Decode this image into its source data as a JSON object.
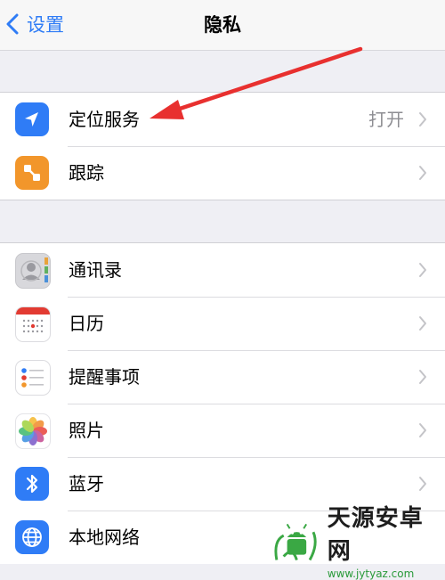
{
  "nav": {
    "back_label": "设置",
    "title": "隐私"
  },
  "group1": [
    {
      "label": "定位服务",
      "value": "打开",
      "icon": "location-arrow-icon",
      "color": "#2f7cf6"
    },
    {
      "label": "跟踪",
      "value": "",
      "icon": "tracking-icon",
      "color": "#f2962b"
    }
  ],
  "group2": [
    {
      "label": "通讯录",
      "icon": "contacts-icon"
    },
    {
      "label": "日历",
      "icon": "calendar-icon"
    },
    {
      "label": "提醒事项",
      "icon": "reminders-icon"
    },
    {
      "label": "照片",
      "icon": "photos-icon"
    },
    {
      "label": "蓝牙",
      "icon": "bluetooth-icon",
      "color": "#2f7cf6"
    },
    {
      "label": "本地网络",
      "icon": "globe-icon",
      "color": "#2f7cf6"
    }
  ],
  "watermark": {
    "title": "天源安卓网",
    "url": "www.jytyaz.com"
  },
  "colors": {
    "accent": "#2f7cf6",
    "annotation_arrow": "#e8302f"
  }
}
